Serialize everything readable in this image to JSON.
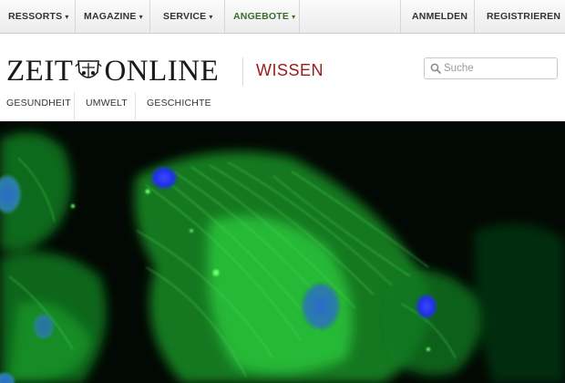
{
  "topnav": {
    "items": [
      {
        "label": "RESSORTS",
        "dropdown": true
      },
      {
        "label": "MAGAZINE",
        "dropdown": true
      },
      {
        "label": "SERVICE",
        "dropdown": true
      },
      {
        "label": "ANGEBOTE",
        "dropdown": true,
        "color": "#3e6b2f"
      }
    ],
    "caret": "▾",
    "login": "ANMELDEN",
    "register": "REGISTRIEREN"
  },
  "header": {
    "logo_left": "ZEIT",
    "logo_right": "ONLINE",
    "section": "WISSEN",
    "section_color": "#9b1b1b",
    "search": {
      "placeholder": "Suche",
      "value": "",
      "icon": "search-icon"
    }
  },
  "subnav": {
    "items": [
      {
        "label": "GESUNDHEIT"
      },
      {
        "label": "UMWELT"
      },
      {
        "label": "GESCHICHTE"
      }
    ]
  },
  "hero": {
    "kind": "fluorescence microscopy photograph",
    "colors": {
      "background": "#020803",
      "cell": "#2fbf3a",
      "nucleus": "#2233ff"
    }
  }
}
